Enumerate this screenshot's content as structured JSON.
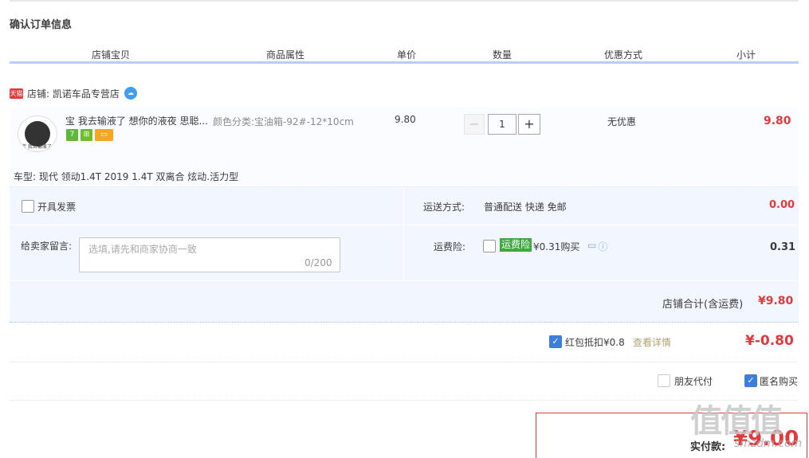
{
  "title": "确认订单信息",
  "table_headers": [
    "店铺宝贝",
    "商品属性",
    "单价",
    "数量",
    "优惠方式",
    "小计"
  ],
  "shop": {
    "badge": "天猫",
    "label": "店铺: 凯诺车品专营店",
    "chat_icon": "wangwang-icon"
  },
  "item": {
    "thumb_caption": "宝 我去输液了",
    "title": "宝 我去输液了 想你的液夜 思聪...",
    "badges": [
      "7",
      "⊞",
      "▭"
    ],
    "sku_label": "颜色分类:",
    "sku_value": "宝油箱-92#-12*10cm",
    "price": "9.80",
    "qty_minus": "−",
    "qty": "1",
    "qty_plus": "+",
    "discount": "无优惠",
    "subtotal": "9.80",
    "car_type": "车型: 现代 领动1.4T 2019 1.4T 双离合 炫动.活力型"
  },
  "invoice": {
    "label": "开具发票",
    "checked": false
  },
  "shipping": {
    "label": "运送方式:",
    "value": "普通配送 快递 免邮",
    "price": "0.00"
  },
  "message": {
    "label": "给卖家留言:",
    "placeholder": "选填,请先和商家协商一致",
    "count": "0/200"
  },
  "insurance": {
    "label": "运费险:",
    "tag": "运费险",
    "text": "¥0.31购买",
    "price": "0.31",
    "checked": false
  },
  "shop_total": {
    "label": "店铺合计(含运费)",
    "value": "¥9.80"
  },
  "red_packet": {
    "label": "红包抵扣¥0.8",
    "link": "查看详情",
    "value": "¥-0.80",
    "checked": true
  },
  "friend_pay": {
    "label": "朋友代付",
    "checked": false
  },
  "anonymous": {
    "label": "匿名购买",
    "checked": true
  },
  "payment": {
    "label": "实付款:",
    "value": "¥9.00"
  },
  "watermark": {
    "main": "值值值",
    "sub": "smzdm.com"
  },
  "colors": {
    "accent": "#e4393c",
    "header_line": "#b2d1ff",
    "panel": "#f2f7ff",
    "check": "#3d7ddd"
  }
}
